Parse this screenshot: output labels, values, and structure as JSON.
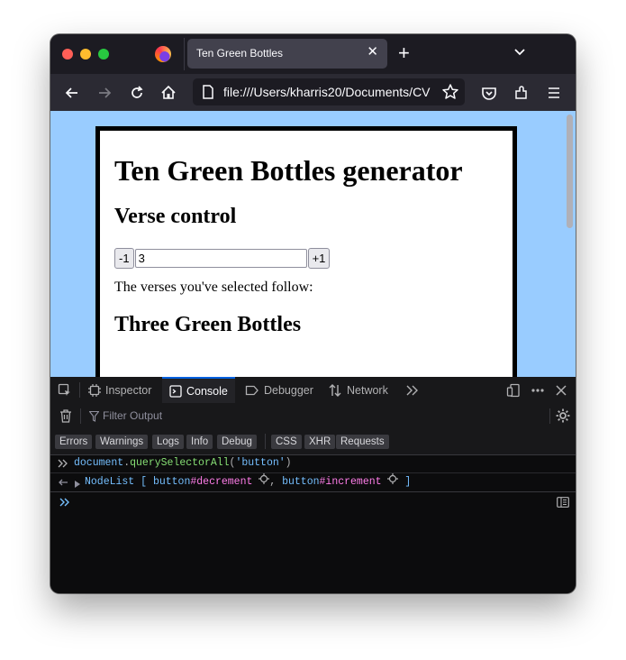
{
  "browser": {
    "tab_title": "Ten Green Bottles",
    "url": "file:///Users/kharris20/Documents/CV"
  },
  "page": {
    "heading": "Ten Green Bottles generator",
    "subheading": "Verse control",
    "decrement_label": "-1",
    "verse_value": "3",
    "increment_label": "+1",
    "intro_text": "The verses you've selected follow:",
    "verse_heading": "Three Green Bottles"
  },
  "devtools": {
    "tabs": [
      "Inspector",
      "Console",
      "Debugger",
      "Network"
    ],
    "selected_tab": "Console",
    "filter_placeholder": "Filter Output",
    "categories": [
      "Errors",
      "Warnings",
      "Logs",
      "Info",
      "Debug",
      "CSS",
      "XHR",
      "Requests"
    ],
    "command": {
      "object": "document",
      "dot": ".",
      "method": "querySelectorAll",
      "open": "(",
      "arg": "'button'",
      "close": ")"
    },
    "result": {
      "type": "NodeList",
      "open": "[",
      "item1_tag": "button",
      "item1_id": "#decrement",
      "separator": ",",
      "item2_tag": "button",
      "item2_id": "#increment",
      "close": "]"
    }
  }
}
